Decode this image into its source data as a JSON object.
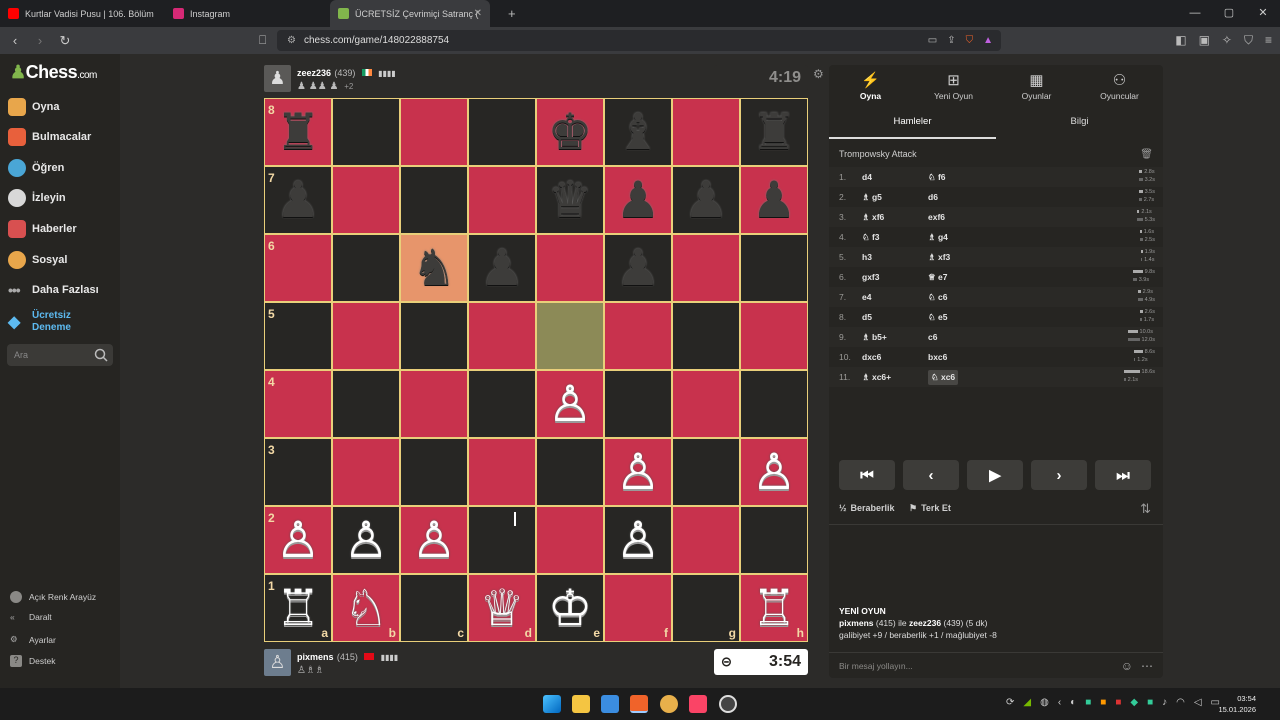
{
  "browser": {
    "tabs": [
      {
        "label": "Kurtlar Vadisi Pusu | 106. Bölüm | Yük",
        "color": "#ff0000"
      },
      {
        "label": "Instagram",
        "color": "#d62976"
      },
      {
        "label": "ÜCRETSİZ Çevrimiçi Satranç (",
        "color": "#81b64c"
      }
    ],
    "url": "chess.com/game/148022888754"
  },
  "sidebar": {
    "logo": "Chess",
    "logo_suffix": ".com",
    "items": [
      {
        "label": "Oyna",
        "color": "#e8a64b"
      },
      {
        "label": "Bulmacalar",
        "color": "#e8603c"
      },
      {
        "label": "Öğren",
        "color": "#4aa6d6"
      },
      {
        "label": "İzleyin",
        "color": "#d8d8d8"
      },
      {
        "label": "Haberler",
        "color": "#d85050"
      },
      {
        "label": "Sosyal",
        "color": "#e8a64b"
      },
      {
        "label": "Daha Fazlası",
        "color": "#aaaaaa"
      }
    ],
    "trial": "Ücretsiz Deneme",
    "search_placeholder": "Ara",
    "footer": [
      "Açık Renk Arayüz",
      "Daralt",
      "Ayarlar",
      "Destek"
    ]
  },
  "top_player": {
    "name": "zeez236",
    "rating": "(439)",
    "captures": "♟ ♟♟ ♟",
    "capture_adv": "+2",
    "clock": "4:19"
  },
  "bottom_player": {
    "name": "pixmens",
    "rating": "(415)",
    "captures": "♙♗♗",
    "clock": "3:54"
  },
  "board": {
    "ranks": [
      "8",
      "7",
      "6",
      "5",
      "4",
      "3",
      "2",
      "1"
    ],
    "files": [
      "a",
      "b",
      "c",
      "d",
      "e",
      "f",
      "g",
      "h"
    ],
    "squares": [
      [
        "♜",
        "",
        "",
        "",
        "♚",
        "♝",
        "",
        "♜"
      ],
      [
        "♟",
        "",
        "",
        "",
        "♛",
        "♟",
        "♟",
        "♟"
      ],
      [
        "",
        "",
        "♞",
        "♟",
        "",
        "♟",
        "",
        ""
      ],
      [
        "",
        "",
        "",
        "",
        "",
        "",
        "",
        ""
      ],
      [
        "",
        "",
        "",
        "",
        "♙",
        "",
        "",
        ""
      ],
      [
        "",
        "",
        "",
        "",
        "",
        "♙",
        "",
        "♙"
      ],
      [
        "♙",
        "♙",
        "♙",
        "",
        "",
        "♙",
        "",
        ""
      ],
      [
        "♖",
        "♘",
        "",
        "♕",
        "♔",
        "",
        "",
        "♖"
      ]
    ],
    "highlights": [
      "c6",
      "e5"
    ],
    "colors": {
      "light": "#c8324d",
      "dark": "#272624"
    }
  },
  "panel": {
    "tabs": [
      {
        "label": "Oyna",
        "icon": "lightning-icon"
      },
      {
        "label": "Yeni Oyun",
        "icon": "plus-square-icon"
      },
      {
        "label": "Oyunlar",
        "icon": "grid-icon"
      },
      {
        "label": "Oyuncular",
        "icon": "players-icon"
      }
    ],
    "subtabs": [
      "Hamleler",
      "Bilgi"
    ],
    "opening": "Trompowsky Attack",
    "moves": [
      {
        "n": "1.",
        "w": "d4",
        "b": "♘ f6",
        "tw": "2.8s",
        "tb": "3.2s"
      },
      {
        "n": "2.",
        "w": "♗ g5",
        "b": "d6",
        "tw": "3.5s",
        "tb": "2.7s"
      },
      {
        "n": "3.",
        "w": "♗ xf6",
        "b": "exf6",
        "tw": "2.1s",
        "tb": "5.3s"
      },
      {
        "n": "4.",
        "w": "♘ f3",
        "b": "♗ g4",
        "tw": "1.6s",
        "tb": "2.5s"
      },
      {
        "n": "5.",
        "w": "h3",
        "b": "♗ xf3",
        "tw": "1.9s",
        "tb": "1.4s"
      },
      {
        "n": "6.",
        "w": "gxf3",
        "b": "♕ e7",
        "tw": "9.8s",
        "tb": "3.9s"
      },
      {
        "n": "7.",
        "w": "e4",
        "b": "♘ c6",
        "tw": "2.9s",
        "tb": "4.9s"
      },
      {
        "n": "8.",
        "w": "d5",
        "b": "♘ e5",
        "tw": "2.6s",
        "tb": "1.7s"
      },
      {
        "n": "9.",
        "w": "♗ b5+",
        "b": "c6",
        "tw": "10.0s",
        "tb": "12.0s"
      },
      {
        "n": "10.",
        "w": "dxc6",
        "b": "bxc6",
        "tw": "8.6s",
        "tb": "1.2s"
      },
      {
        "n": "11.",
        "w": "♗ xc6+",
        "b": "♘ xc6",
        "tw": "18.6s",
        "tb": "2.1s"
      }
    ],
    "draw": "Beraberlik",
    "resign": "Terk Et",
    "new_game_title": "YENİ OYUN",
    "new_game_line1_a": "pixmens",
    "new_game_line1_b": "(415) ile",
    "new_game_line1_c": "zeez236",
    "new_game_line1_d": "(439) (5 dk)",
    "new_game_stats": "galibiyet +9 / beraberlik +1 / mağlubiyet -8",
    "chat_placeholder": "Bir mesaj yollayın..."
  },
  "taskbar": {
    "time": "03:54",
    "date": "15.01.2026"
  }
}
